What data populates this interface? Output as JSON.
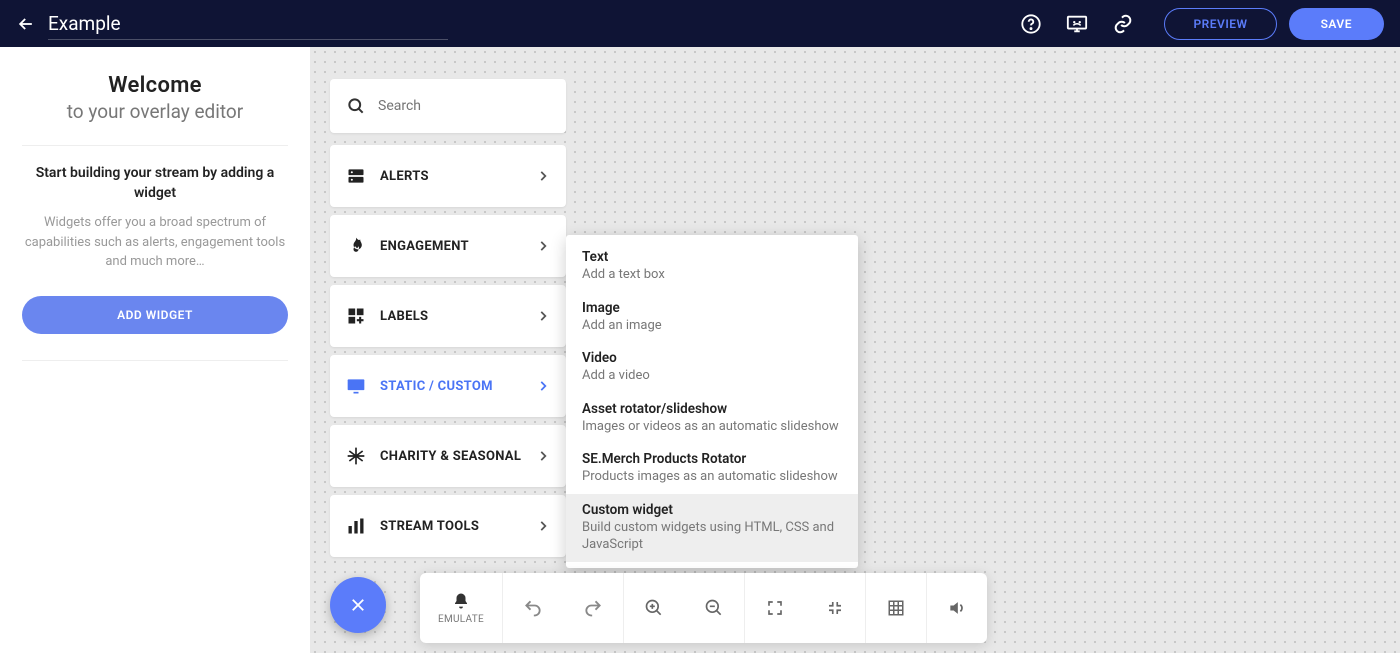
{
  "header": {
    "title": "Example",
    "preview_label": "PREVIEW",
    "save_label": "SAVE"
  },
  "sidebar": {
    "welcome_title": "Welcome",
    "welcome_subtitle": "to your overlay editor",
    "start_heading": "Start building your stream by adding a widget",
    "start_description": "Widgets offer you a broad spectrum of capabilities such as alerts, engagement tools and much more…",
    "add_widget_label": "ADD WIDGET"
  },
  "search": {
    "placeholder": "Search"
  },
  "categories": [
    {
      "label": "ALERTS",
      "icon": "server"
    },
    {
      "label": "ENGAGEMENT",
      "icon": "flame"
    },
    {
      "label": "LABELS",
      "icon": "squares"
    },
    {
      "label": "STATIC / CUSTOM",
      "icon": "monitor",
      "active": true
    },
    {
      "label": "CHARITY & SEASONAL",
      "icon": "snow"
    },
    {
      "label": "STREAM TOOLS",
      "icon": "bars"
    }
  ],
  "submenu": [
    {
      "title": "Text",
      "desc": "Add a text box"
    },
    {
      "title": "Image",
      "desc": "Add an image"
    },
    {
      "title": "Video",
      "desc": "Add a video"
    },
    {
      "title": "Asset rotator/slideshow",
      "desc": "Images or videos as an automatic slideshow"
    },
    {
      "title": "SE.Merch Products Rotator",
      "desc": "Products images as an automatic slideshow"
    },
    {
      "title": "Custom widget",
      "desc": "Build custom widgets using HTML, CSS and JavaScript",
      "hover": true
    }
  ],
  "toolbar": {
    "emulate_label": "EMULATE"
  }
}
